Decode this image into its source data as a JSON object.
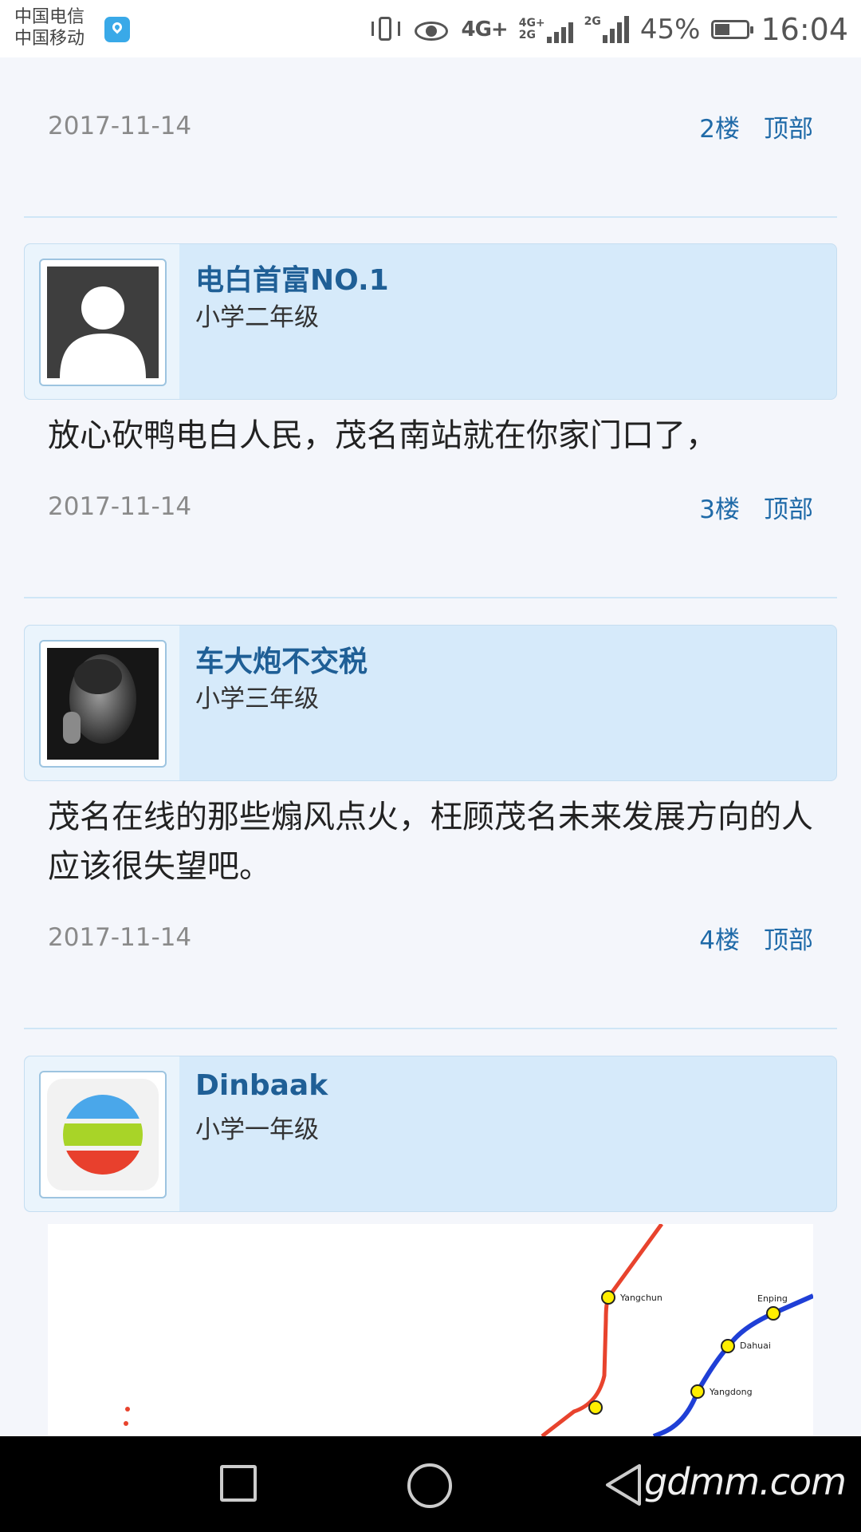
{
  "status_bar": {
    "carrier_1": "中国电信",
    "carrier_2": "中国移动",
    "network_1": "4G+",
    "network_2_top": "4G+",
    "network_2_bottom": "2G",
    "network_3": "2G",
    "battery_percent": "45%",
    "battery_level": 0.45,
    "time": "16:04"
  },
  "posts": [
    {
      "date": "2017-11-14",
      "floor": "2楼",
      "top_link": "顶部"
    },
    {
      "user": {
        "name": "电白首富NO.1",
        "level": "小学二年级"
      },
      "text": "放心砍鸭电白人民，茂名南站就在你家门口了，",
      "date": "2017-11-14",
      "floor": "3楼",
      "top_link": "顶部"
    },
    {
      "user": {
        "name": "车大炮不交税",
        "level": "小学三年级"
      },
      "text": "茂名在线的那些煽风点火，枉顾茂名未来发展方向的人应该很失望吧。",
      "date": "2017-11-14",
      "floor": "4楼",
      "top_link": "顶部"
    },
    {
      "user": {
        "name": "Dinbaak",
        "level": "小学一年级"
      },
      "map": {
        "stations": [
          "Yangchun",
          "Enping",
          "Dahuai",
          "Yangdong"
        ],
        "line_colors": {
          "red": "#e8432d",
          "blue": "#1f3fd6",
          "station": "#ffee00"
        }
      }
    }
  ],
  "nav": {
    "watermark": "gdmm.com"
  }
}
